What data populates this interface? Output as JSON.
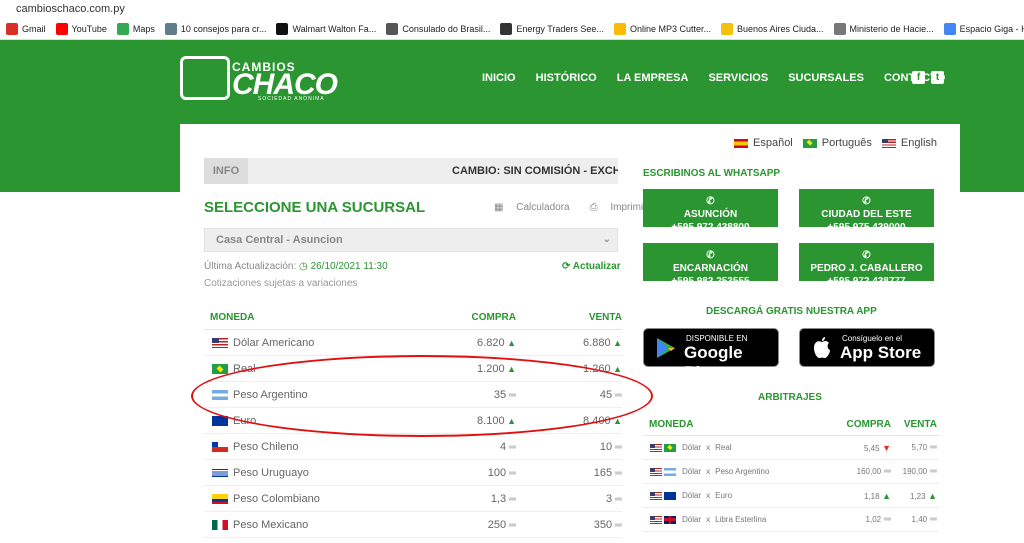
{
  "browser": {
    "url": "cambioschaco.com.py",
    "bookmarks": [
      {
        "label": "Gmail",
        "color": "#d93025"
      },
      {
        "label": "YouTube",
        "color": "#ff0000"
      },
      {
        "label": "Maps",
        "color": "#34a853"
      },
      {
        "label": "10 consejos para cr...",
        "color": "#607d8b"
      },
      {
        "label": "Walmart Walton Fa...",
        "color": "#111111"
      },
      {
        "label": "Consulado do Brasil...",
        "color": "#555555"
      },
      {
        "label": "Energy Traders See...",
        "color": "#333333"
      },
      {
        "label": "Online MP3 Cutter...",
        "color": "#fbbc05"
      },
      {
        "label": "Buenos Aires Ciuda...",
        "color": "#f4c20d"
      },
      {
        "label": "Ministerio de Hacie...",
        "color": "#777777"
      },
      {
        "label": "Espacio Giga - Home",
        "color": "#4285f4"
      }
    ]
  },
  "brand": {
    "line1": "CAMBIOS",
    "line2": "CHACO",
    "line3": "SOCIEDAD ANONIMA"
  },
  "nav": [
    "INICIO",
    "HISTÓRICO",
    "LA EMPRESA",
    "SERVICIOS",
    "SUCURSALES",
    "CONTACTO"
  ],
  "languages": [
    {
      "label": "Español",
      "flag": "es"
    },
    {
      "label": "Português",
      "flag": "br"
    },
    {
      "label": "English",
      "flag": "us"
    }
  ],
  "ticker": {
    "label": "INFO",
    "text": "CAMBIO: SIN COMISIÓN - EXCHANG"
  },
  "rates_panel": {
    "title": "SELECCIONE UNA SUCURSAL",
    "calculator": "Calculadora",
    "print": "Imprimir",
    "branch": "Casa Central - Asuncion",
    "updated_label": "Última Actualización:",
    "updated_value": "26/10/2021 11:30",
    "refresh": "Actualizar",
    "note": "Cotizaciones sujetas a variaciones",
    "headers": {
      "currency": "MONEDA",
      "buy": "COMPRA",
      "sell": "VENTA"
    },
    "rows": [
      {
        "name": "Dólar Americano",
        "flag": "us",
        "buy": "6.820",
        "sell": "6.880",
        "bt": "up",
        "st": "up"
      },
      {
        "name": "Real",
        "flag": "br",
        "buy": "1.200",
        "sell": "1.260",
        "bt": "up",
        "st": "up"
      },
      {
        "name": "Peso Argentino",
        "flag": "ar",
        "buy": "35",
        "sell": "45",
        "bt": "eq",
        "st": "eq"
      },
      {
        "name": "Euro",
        "flag": "eu",
        "buy": "8.100",
        "sell": "8.400",
        "bt": "up",
        "st": "up"
      },
      {
        "name": "Peso Chileno",
        "flag": "cl",
        "buy": "4",
        "sell": "10",
        "bt": "eq",
        "st": "eq"
      },
      {
        "name": "Peso Uruguayo",
        "flag": "uy",
        "buy": "100",
        "sell": "165",
        "bt": "eq",
        "st": "eq"
      },
      {
        "name": "Peso Colombiano",
        "flag": "co",
        "buy": "1,3",
        "sell": "3",
        "bt": "eq",
        "st": "eq"
      },
      {
        "name": "Peso Mexicano",
        "flag": "mx",
        "buy": "250",
        "sell": "350",
        "bt": "eq",
        "st": "eq"
      }
    ]
  },
  "whatsapp": {
    "title": "ESCRIBINOS AL WHATSAPP",
    "buttons": [
      {
        "city": "ASUNCIÓN",
        "phone": "+595 972 438800"
      },
      {
        "city": "CIUDAD DEL ESTE",
        "phone": "+595 975 439000"
      },
      {
        "city": "ENCARNACIÓN",
        "phone": "+595 983 253555"
      },
      {
        "city": "PEDRO J. CABALLERO",
        "phone": "+595 972 438777"
      }
    ]
  },
  "apps": {
    "title": "DESCARGÁ GRATIS NUESTRA APP",
    "google_small": "DISPONIBLE EN",
    "google_big": "Google Play",
    "apple_small": "Consíguelo en el",
    "apple_big": "App Store"
  },
  "arbitrajes": {
    "title": "ARBITRAJES",
    "headers": {
      "currency": "MONEDA",
      "buy": "COMPRA",
      "sell": "VENTA"
    },
    "rows": [
      {
        "a": "Dólar",
        "b": "Real",
        "fa": "us",
        "fb": "br",
        "buy": "5,45",
        "sell": "5,70",
        "bt": "dn",
        "st": "eq"
      },
      {
        "a": "Dólar",
        "b": "Peso Argentino",
        "fa": "us",
        "fb": "ar",
        "buy": "160,00",
        "sell": "190,00",
        "bt": "eq",
        "st": "eq"
      },
      {
        "a": "Dólar",
        "b": "Euro",
        "fa": "us",
        "fb": "eu",
        "buy": "1,18",
        "sell": "1,23",
        "bt": "up",
        "st": "up"
      },
      {
        "a": "Dólar",
        "b": "Libra Esterlina",
        "fa": "us",
        "fb": "gb",
        "buy": "1,02",
        "sell": "1,40",
        "bt": "eq",
        "st": "eq"
      }
    ]
  },
  "colors": {
    "brand_green": "#2a9531",
    "annotation_red": "#e01010"
  }
}
